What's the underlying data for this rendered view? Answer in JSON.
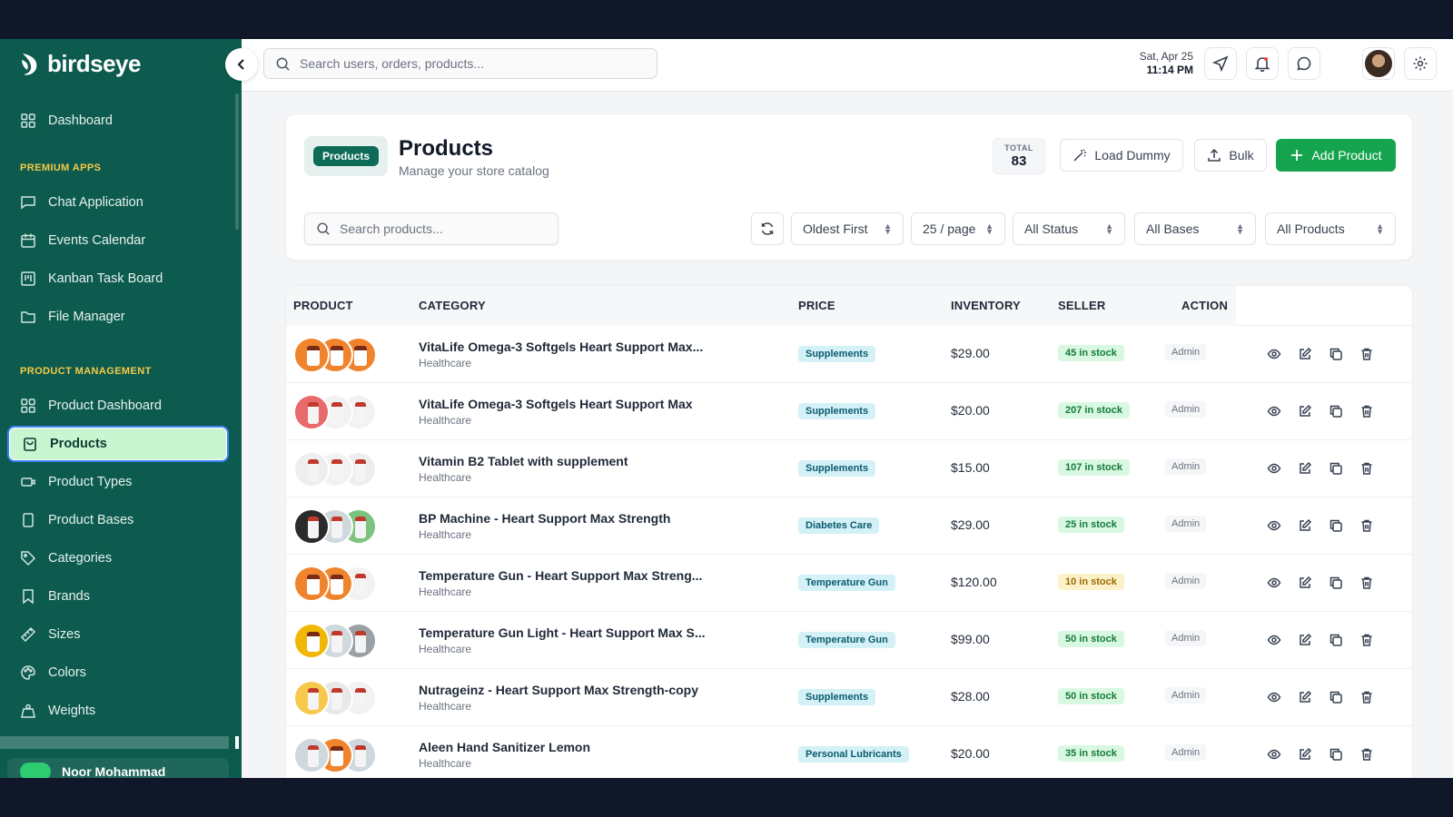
{
  "brand": {
    "name": "birdseye"
  },
  "sidebar": {
    "dashboard": "Dashboard",
    "premium_section": "PREMIUM APPS",
    "premium": [
      "Chat Application",
      "Events Calendar",
      "Kanban Task Board",
      "File Manager"
    ],
    "product_section": "PRODUCT MANAGEMENT",
    "product": [
      "Product Dashboard",
      "Products",
      "Product Types",
      "Product Bases",
      "Categories",
      "Brands",
      "Sizes",
      "Colors",
      "Weights"
    ],
    "active_item": "Products",
    "user_name": "Noor Mohammad"
  },
  "topbar": {
    "search_placeholder": "Search users, orders, products...",
    "date": "Sat, Apr 25",
    "time": "11:14 PM"
  },
  "header": {
    "badge": "Products",
    "title": "Products",
    "subtitle": "Manage your store catalog",
    "total_label": "TOTAL",
    "total_value": "83",
    "load_dummy": "Load Dummy",
    "bulk": "Bulk",
    "add_product": "Add Product"
  },
  "filters": {
    "search_placeholder": "Search products...",
    "sort": "Oldest First",
    "per_page": "25 / page",
    "status": "All Status",
    "bases": "All Bases",
    "products": "All Products"
  },
  "table": {
    "columns": [
      "PRODUCT",
      "CATEGORY",
      "PRICE",
      "INVENTORY",
      "SELLER",
      "ACTION"
    ],
    "rows": [
      {
        "name": "VitaLife Omega-3 Softgels Heart Support Max...",
        "category": "Healthcare",
        "tag": "Supplements",
        "price": "$29.00",
        "stock": "45 in stock",
        "low": false,
        "seller": "Admin"
      },
      {
        "name": "VitaLife Omega-3 Softgels Heart Support Max",
        "category": "Healthcare",
        "tag": "Supplements",
        "price": "$20.00",
        "stock": "207 in stock",
        "low": false,
        "seller": "Admin"
      },
      {
        "name": "Vitamin B2 Tablet with supplement",
        "category": "Healthcare",
        "tag": "Supplements",
        "price": "$15.00",
        "stock": "107 in stock",
        "low": false,
        "seller": "Admin"
      },
      {
        "name": "BP Machine - Heart Support Max Strength",
        "category": "Healthcare",
        "tag": "Diabetes Care",
        "price": "$29.00",
        "stock": "25 in stock",
        "low": false,
        "seller": "Admin"
      },
      {
        "name": "Temperature Gun - Heart Support Max Streng...",
        "category": "Healthcare",
        "tag": "Temperature Gun",
        "price": "$120.00",
        "stock": "10 in stock",
        "low": true,
        "seller": "Admin"
      },
      {
        "name": "Temperature Gun Light - Heart Support Max S...",
        "category": "Healthcare",
        "tag": "Temperature Gun",
        "price": "$99.00",
        "stock": "50 in stock",
        "low": false,
        "seller": "Admin"
      },
      {
        "name": "Nutrageinz - Heart Support Max Strength-copy",
        "category": "Healthcare",
        "tag": "Supplements",
        "price": "$28.00",
        "stock": "50 in stock",
        "low": false,
        "seller": "Admin"
      },
      {
        "name": "Aleen Hand Sanitizer Lemon",
        "category": "Healthcare",
        "tag": "Personal Lubricants",
        "price": "$20.00",
        "stock": "35 in stock",
        "low": false,
        "seller": "Admin"
      }
    ]
  },
  "colors": {
    "sidebar": "#0d5b4e",
    "accent_green": "#14a44d",
    "active_bg": "#c9f6d0",
    "section_label": "#f7c948"
  },
  "icons": [
    "search-icon",
    "chevron-left-icon",
    "send-icon",
    "bell-icon",
    "chat-icon",
    "gear-icon",
    "wand-icon",
    "upload-icon",
    "plus-icon",
    "refresh-icon",
    "eye-icon",
    "edit-icon",
    "copy-icon",
    "trash-icon"
  ]
}
